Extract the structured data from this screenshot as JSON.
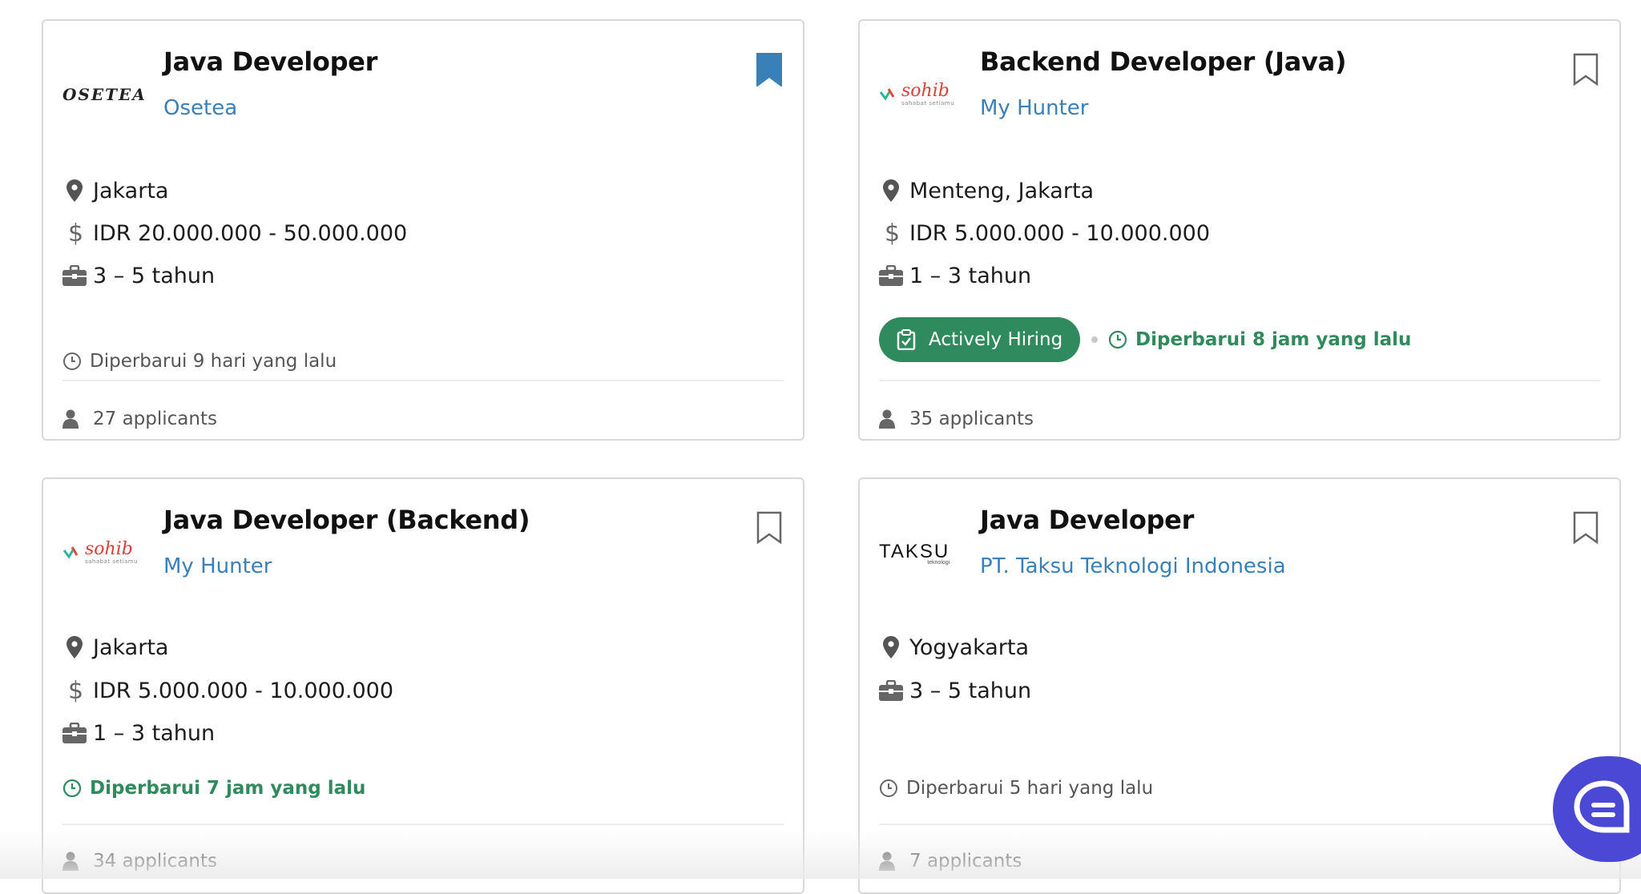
{
  "jobs": [
    {
      "title": "Java Developer",
      "company": "Osetea",
      "logo_text": "OSETEA",
      "location": "Jakarta",
      "salary": "IDR 20.000.000 - 50.000.000",
      "experience": "3 – 5 tahun",
      "updated": "Diperbarui 9 hari yang lalu",
      "applicants": "27 applicants",
      "bookmarked": true
    },
    {
      "title": "Backend Developer (Java)",
      "company": "My Hunter",
      "logo_text": "sohib",
      "logo_sub": "sahabat setiamu",
      "location": "Menteng, Jakarta",
      "salary": "IDR 5.000.000 - 10.000.000",
      "experience": "1 – 3 tahun",
      "badge": "Actively Hiring",
      "updated": "Diperbarui 8 jam yang lalu",
      "applicants": "35 applicants",
      "bookmarked": false
    },
    {
      "title": "Java Developer (Backend)",
      "company": "My Hunter",
      "logo_text": "sohib",
      "logo_sub": "sahabat setiamu",
      "location": "Jakarta",
      "salary": "IDR 5.000.000 - 10.000.000",
      "experience": "1 – 3 tahun",
      "updated": "Diperbarui 7 jam yang lalu",
      "applicants": "34 applicants",
      "bookmarked": false
    },
    {
      "title": "Java Developer",
      "company": "PT. Taksu Teknologi Indonesia",
      "logo_text": "TAKSU",
      "logo_sub": "teknologi",
      "location": "Yogyakarta",
      "experience": "3 – 5 tahun",
      "updated": "Diperbarui 5 hari yang lalu",
      "applicants": "7 applicants",
      "bookmarked": false
    }
  ],
  "colors": {
    "link": "#3a80b8",
    "green": "#2f8a5e",
    "bookmark_active": "#3a80b8",
    "chat": "#4b48d6"
  },
  "icons": {
    "location": "map-pin-icon",
    "salary": "dollar-icon",
    "experience": "briefcase-icon",
    "updated": "clock-icon",
    "applicants": "person-icon",
    "bookmark": "bookmark-icon",
    "chat": "chat-icon"
  }
}
